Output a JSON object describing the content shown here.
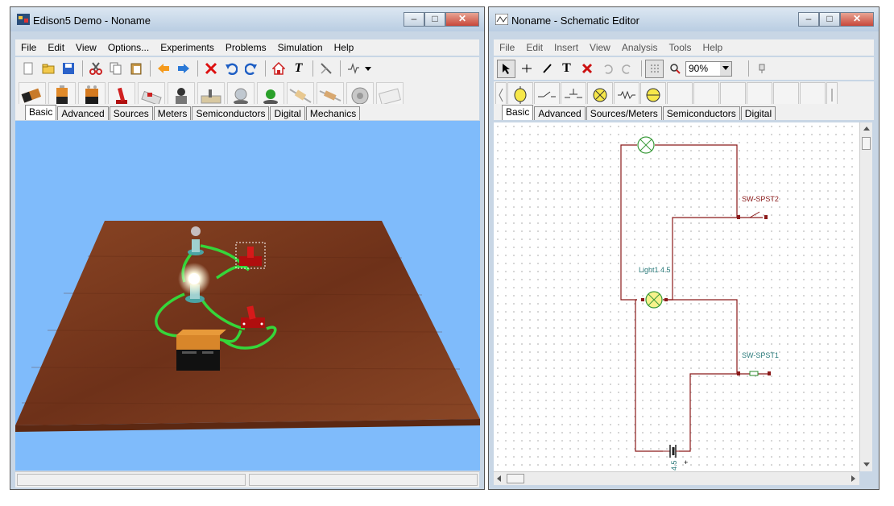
{
  "left_window": {
    "title": "Edison5 Demo - Noname",
    "menu": [
      "File",
      "Edit",
      "View",
      "Options...",
      "Experiments",
      "Problems",
      "Simulation",
      "Help"
    ],
    "toolbar_icons": [
      "new-file-icon",
      "open-folder-icon",
      "save-icon",
      "cut-icon",
      "copy-icon",
      "paste-icon",
      "arrow-left-icon",
      "arrow-right-icon",
      "delete-icon",
      "undo-icon",
      "redo-icon",
      "home-icon",
      "text-icon",
      "probe-icon",
      "waveform-icon"
    ],
    "parts": [
      "battery-aa",
      "battery-c",
      "battery-9v",
      "red-switch",
      "push-button",
      "knife-switch",
      "toggle-switch",
      "bulb-socket",
      "green-led",
      "resistor",
      "resistor-variable",
      "motor",
      "breadboard"
    ],
    "tabs": [
      "Basic",
      "Advanced",
      "Sources",
      "Meters",
      "Semiconductors",
      "Digital",
      "Mechanics"
    ],
    "active_tab": "Basic",
    "colors": {
      "workspace_bg": "#7fbbfb",
      "table": "#7b3a1e",
      "wire": "#35d63a",
      "switch": "#cc1111"
    }
  },
  "right_window": {
    "title": "Noname - Schematic Editor",
    "menu": [
      "File",
      "Edit",
      "Insert",
      "View",
      "Analysis",
      "Tools",
      "Help"
    ],
    "zoom": "90%",
    "tabs": [
      "Basic",
      "Advanced",
      "Sources/Meters",
      "Semiconductors",
      "Digital"
    ],
    "active_tab": "Basic",
    "labels": {
      "switch2": "SW-SPST2",
      "light1": "Light1 4.5",
      "switch1": "SW-SPST1",
      "battery_value": "4.5",
      "battery_plus": "+"
    },
    "colors": {
      "wire": "#8b1a1a",
      "label_red": "#8b1a1a",
      "label_teal": "#2a7a7a",
      "lamp": "#f7f28c"
    }
  }
}
